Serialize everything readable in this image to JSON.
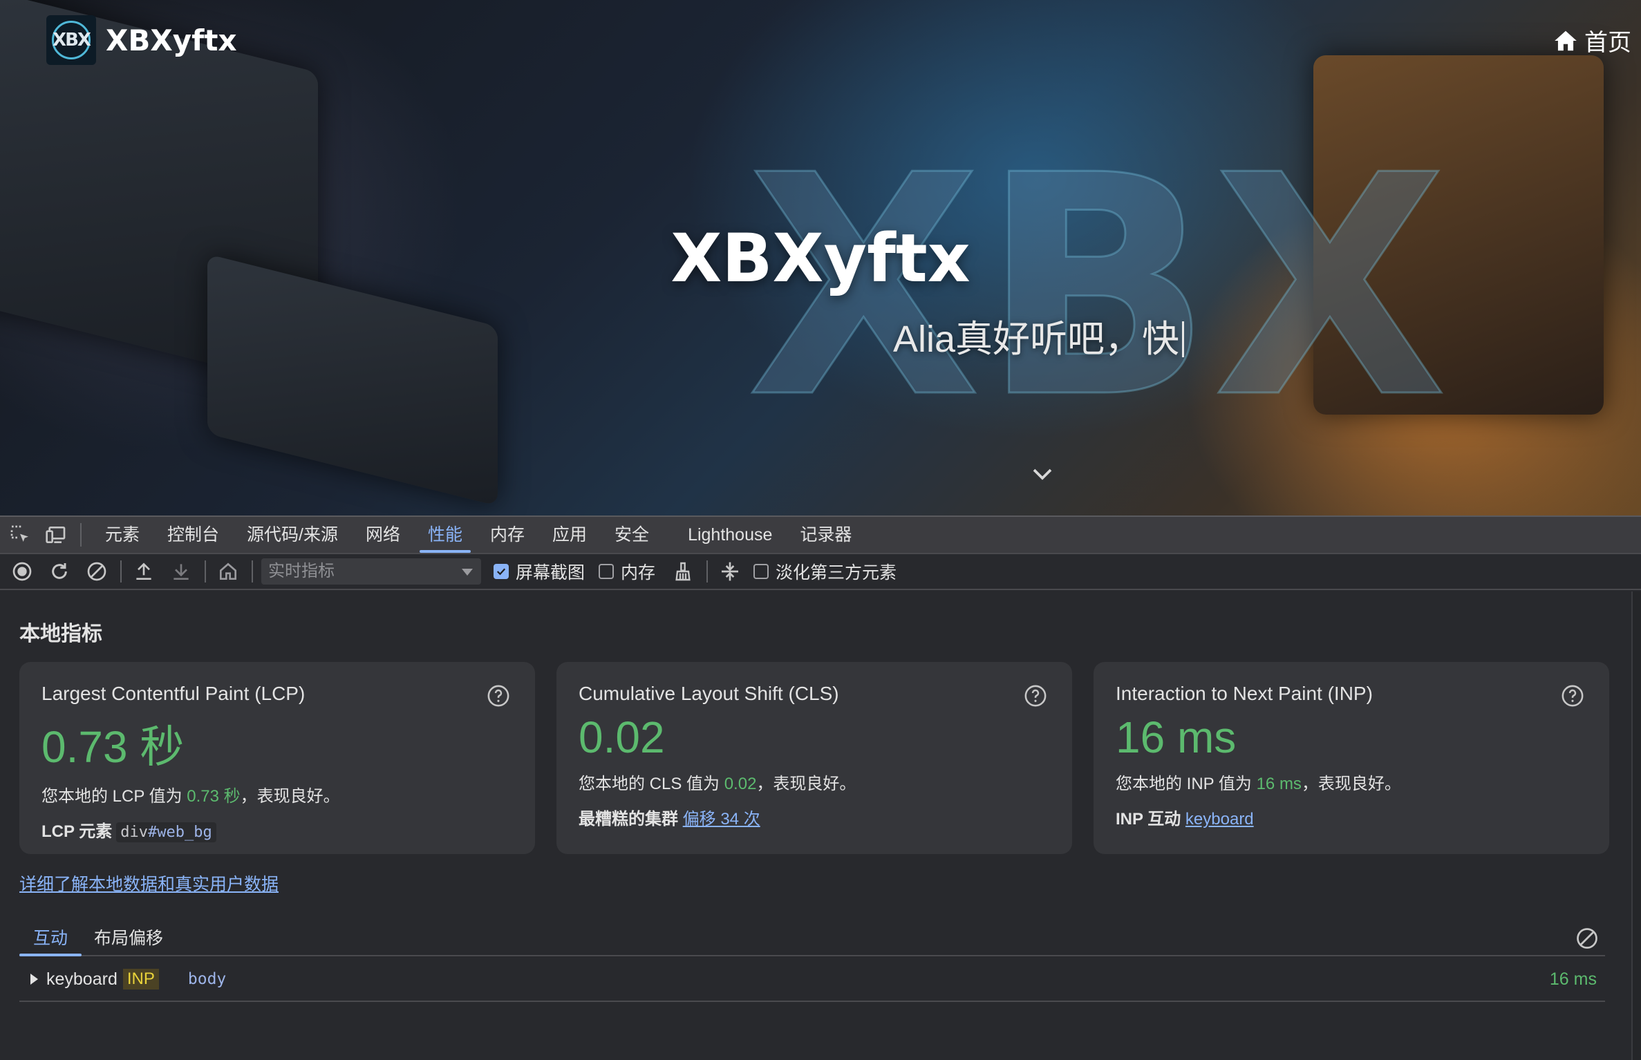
{
  "site": {
    "logo_text": "XBX",
    "name": "XBXyftx",
    "nav_home": "首页",
    "hero_title": "XBXyftx",
    "hero_subtitle": "Alia真好听吧，快"
  },
  "devtools": {
    "panel_tabs": [
      "元素",
      "控制台",
      "源代码/来源",
      "网络",
      "性能",
      "内存",
      "应用",
      "安全",
      "Lighthouse",
      "记录器"
    ],
    "active_tab": "性能",
    "toolbar": {
      "target_placeholder": "实时指标",
      "screenshots_label": "屏幕截图",
      "screenshots_checked": true,
      "memory_label": "内存",
      "memory_checked": false,
      "dim_third_party_label": "淡化第三方元素",
      "dim_third_party_checked": false
    },
    "section_title": "本地指标",
    "cards": {
      "lcp": {
        "title": "Largest Contentful Paint (LCP)",
        "value": "0.73 秒",
        "desc_prefix": "您本地的 LCP 值为 ",
        "desc_value": "0.73 秒",
        "desc_suffix": "，表现良好。",
        "meta_label": "LCP 元素",
        "meta_tag": "div",
        "meta_selector": "#web_bg"
      },
      "cls": {
        "title": "Cumulative Layout Shift (CLS)",
        "value": "0.02",
        "desc_prefix": "您本地的 CLS 值为 ",
        "desc_value": "0.02",
        "desc_suffix": "，表现良好。",
        "meta_label": "最糟糕的集群",
        "meta_link": "偏移 34 次"
      },
      "inp": {
        "title": "Interaction to Next Paint (INP)",
        "value": "16 ms",
        "desc_prefix": "您本地的 INP 值为 ",
        "desc_value": "16 ms",
        "desc_suffix": "，表现良好。",
        "meta_label": "INP 互动",
        "meta_link": "keyboard"
      }
    },
    "learn_more": "详细了解本地数据和真实用户数据",
    "subtabs": [
      "互动",
      "布局偏移"
    ],
    "interactions": [
      {
        "name": "keyboard",
        "badge": "INP",
        "node": "body",
        "duration": "16 ms"
      }
    ],
    "colors": {
      "accent": "#8ab4f8",
      "good": "#5cba6e",
      "card_bg": "#35363a",
      "panel_bg": "#28292d"
    }
  }
}
